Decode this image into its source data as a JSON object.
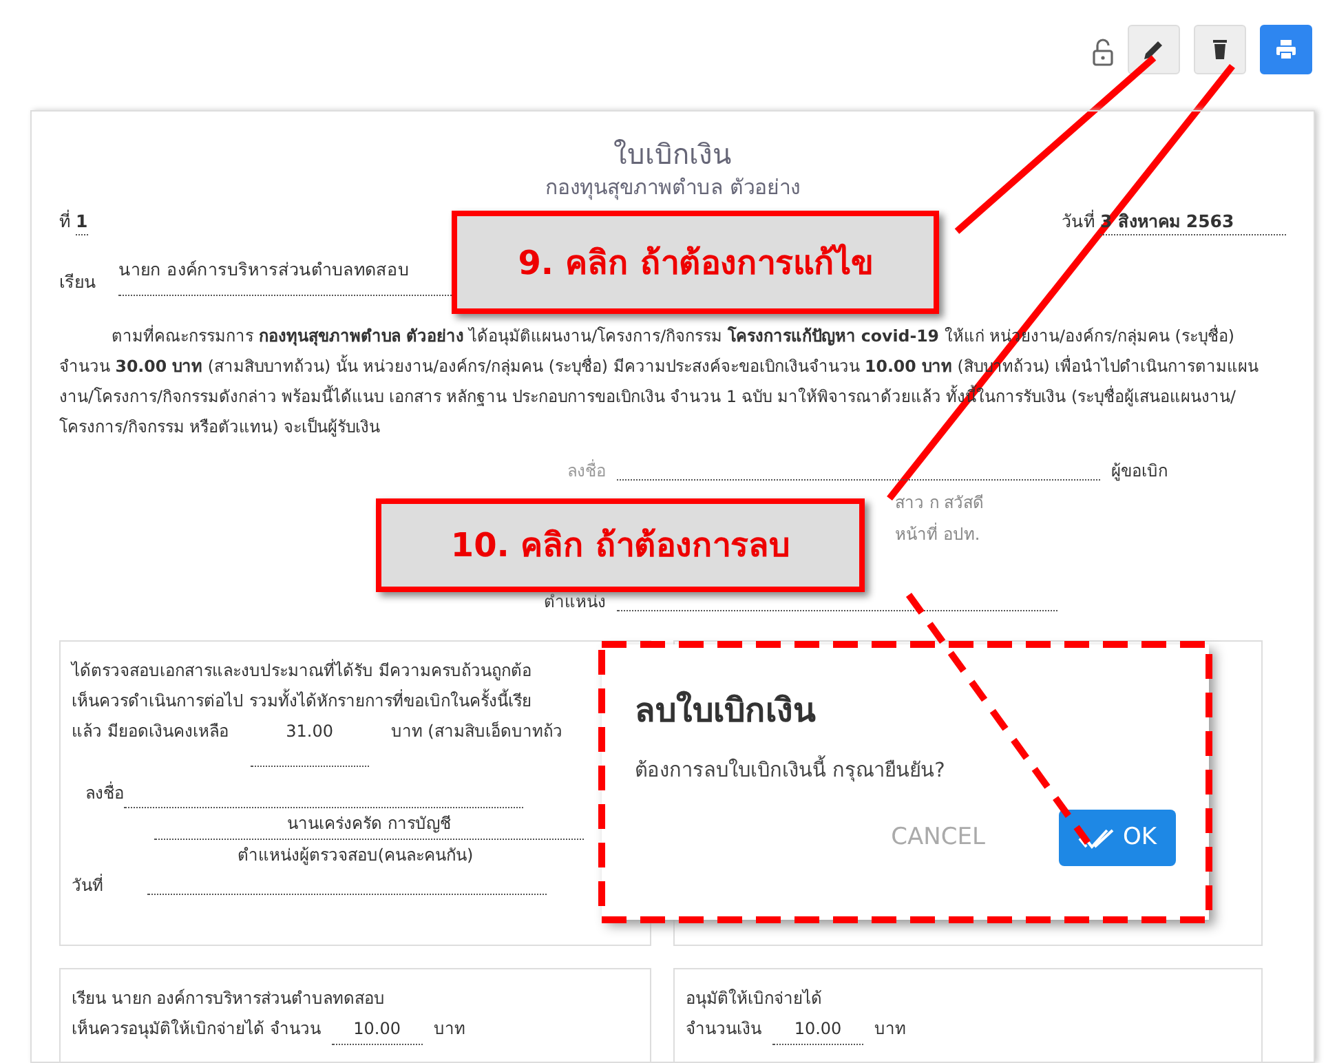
{
  "toolbar": {
    "buttons": [
      {
        "kind": "edit"
      },
      {
        "kind": "delete"
      },
      {
        "kind": "print"
      }
    ]
  },
  "document": {
    "title": "ใบเบิกเงิน",
    "subtitle": "กองทุนสุขภาพตำบล ตัวอย่าง",
    "number_label": "ที่",
    "number": "1",
    "date_label": "วันที่",
    "date": "3 สิงหาคม 2563",
    "to_label": "เรียน",
    "to": "นายก องค์การบริหารส่วนตำบลทดสอบ",
    "body": "ตามที่คณะกรรมการ **กองทุนสุขภาพตำบล ตัวอย่าง** ได้อนุมัติแผนงาน/โครงการ/กิจกรรม **โครงการแก้ปัญหา covid-19** ให้แก่ หน่วยงาน/องค์กร/กลุ่มคน (ระบุชื่อ) จำนวน **30.00 บาท** (สามสิบบาทถ้วน) นั้น หน่วยงาน/องค์กร/กลุ่มคน (ระบุชื่อ) มีความประสงค์จะขอเบิกเงินจำนวน **10.00 บาท** (สิบบาทถ้วน) เพื่อนำไปดำเนินการตามแผนงาน/โครงการ/กิจกรรมดังกล่าว พร้อมนี้ได้แนบ เอกสาร หลักฐาน ประกอบการขอเบิกเงิน จำนวน 1 ฉบับ มาให้พิจารณาด้วยแล้ว ทั้งนี้ในการรับเงิน (ระบุชื่อผู้เสนอแผนงาน/โครงการ/กิจกรรม หรือตัวแทน) จะเป็นผู้รับเงิน",
    "signature": {
      "sign_label": "ลงชื่อ",
      "role": "ผู้ขอเบิก",
      "name": "สาว ก สวัสดี",
      "position": "หน้าที่ อปท.",
      "position_label": "ตำแหน่ง"
    },
    "check_box": {
      "line_1": "ได้ตรวจสอบเอกสารและงบประมาณที่ได้รับ มีความครบถ้วนถูกต้อ",
      "line_2": "เห็นควรดำเนินการต่อไป รวมทั้งได้หักรายการที่ขอเบิกในครั้งนี้เรีย",
      "balance_label": "แล้ว มียอดเงินคงเหลือ",
      "balance": "31.00",
      "balance_words": "บาท (สามสิบเอ็ดบาทถ้ว",
      "sign_label": "ลงชื่อ",
      "name": "นานเคร่งครัด การบัญชี",
      "position": "ตำแหน่งผู้ตรวจสอบ(คนละคนกัน)",
      "date_label": "วันที่"
    },
    "recommend_box": {
      "line_1": "เรียน นายก องค์การบริหารส่วนตำบลทดสอบ",
      "amount_label": "เห็นควรอนุมัติให้เบิกจ่ายได้ จำนวน",
      "amount": "10.00",
      "unit": "บาท"
    },
    "approve_box": {
      "line_1": "อนุมัติให้เบิกจ่ายได้",
      "amount_label": "จำนวนเงิน",
      "amount": "10.00",
      "unit": "บาท"
    }
  },
  "annotations": [
    {
      "text": "9. คลิก ถ้าต้องการแก้ไข"
    },
    {
      "text": "10. คลิก ถ้าต้องการลบ"
    }
  ],
  "dialog": {
    "title": "ลบใบเบิกเงิน",
    "message": "ต้องการลบใบเบิกเงินนี้ กรุณายืนยัน?",
    "buttons": [
      {
        "label": "CANCEL",
        "kind": "cancel"
      },
      {
        "label": "OK",
        "kind": "confirm"
      }
    ]
  }
}
